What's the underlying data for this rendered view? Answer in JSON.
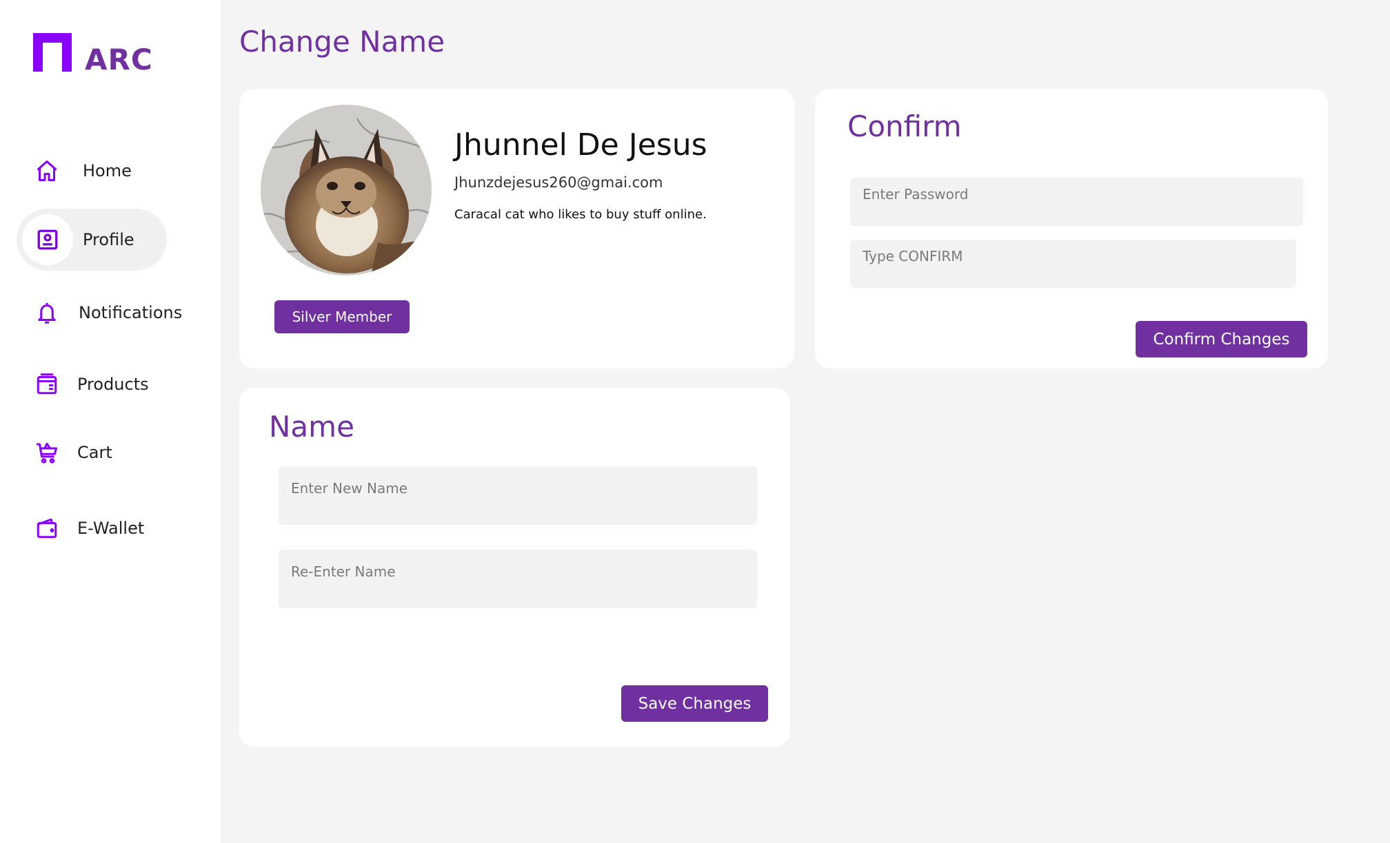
{
  "app": {
    "brand": "ARC",
    "accent_color": "#7030a0",
    "logo_color": "#8a00ff"
  },
  "sidebar": {
    "items": [
      {
        "label": "Home",
        "icon": "home-icon",
        "active": false
      },
      {
        "label": "Profile",
        "icon": "profile-card-icon",
        "active": true
      },
      {
        "label": "Notifications",
        "icon": "bell-icon",
        "active": false
      },
      {
        "label": "Products",
        "icon": "product-box-icon",
        "active": false
      },
      {
        "label": "Cart",
        "icon": "cart-icon",
        "active": false
      },
      {
        "label": "E-Wallet",
        "icon": "wallet-icon",
        "active": false
      }
    ]
  },
  "page": {
    "title": "Change Name"
  },
  "profile": {
    "name": "Jhunnel De Jesus",
    "email": "Jhunzdejesus260@gmai.com",
    "bio": "Caracal cat who likes to buy stuff online.",
    "membership": "Silver Member",
    "avatar": "caracal-cat-photo"
  },
  "confirm": {
    "heading": "Confirm",
    "password_placeholder": "Enter Password",
    "confirm_placeholder": "Type CONFIRM",
    "button_label": "Confirm Changes"
  },
  "name_form": {
    "heading": "Name",
    "new_name_placeholder": "Enter New Name",
    "reenter_placeholder": "Re-Enter Name",
    "button_label": "Save Changes"
  }
}
